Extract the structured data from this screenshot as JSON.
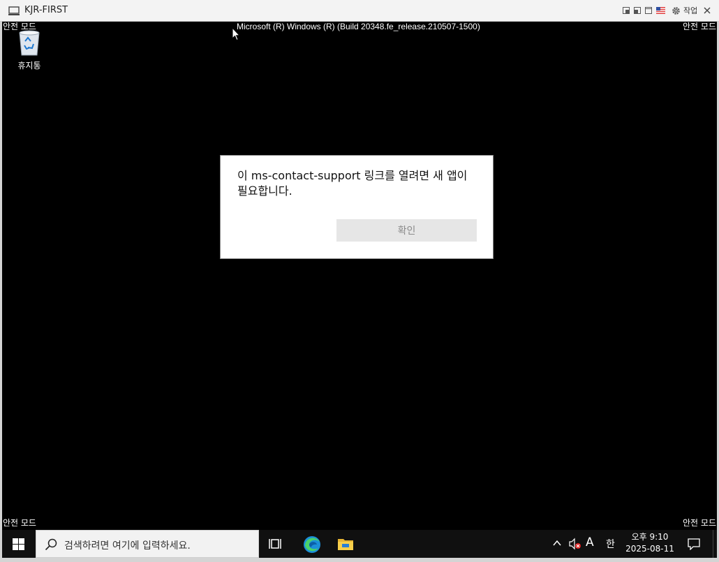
{
  "window": {
    "title": "KJR-FIRST",
    "work_label": "작업",
    "icons": [
      "computer-icon",
      "pip-icon",
      "restore-icon",
      "maximize-icon",
      "flag-icon",
      "gear-icon",
      "close-icon"
    ]
  },
  "desktop": {
    "safe_mode_label": "안전 모드",
    "build_text": "Microsoft (R) Windows (R) (Build 20348.fe_release.210507-1500)",
    "recycle_bin_label": "휴지통"
  },
  "dialog": {
    "message": "이 ms-contact-support 링크를 열려면 새 앱이 필요합니다.",
    "ok_label": "확인"
  },
  "taskbar": {
    "search_placeholder": "검색하려면 여기에 입력하세요.",
    "ime_mode": "A",
    "ime_lang": "한",
    "clock_time": "오후 9:10",
    "clock_date": "2025-08-11",
    "accent": "#0078d7"
  }
}
